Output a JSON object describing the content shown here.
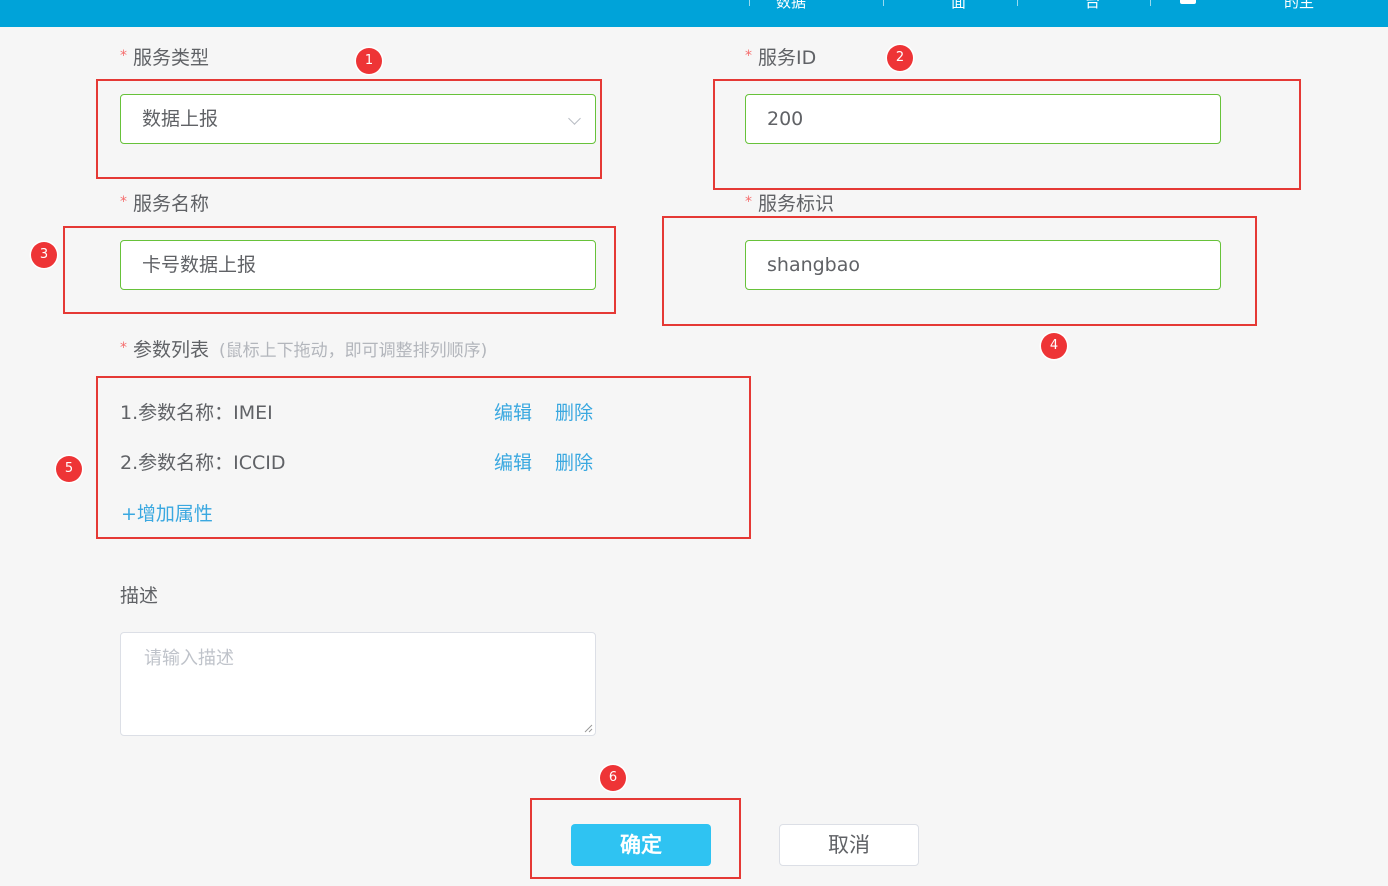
{
  "header": {
    "nav_fragments": [
      "数据",
      "面",
      "台",
      "的主"
    ],
    "background": "#00a3d9"
  },
  "form": {
    "service_type": {
      "label": "服务类型",
      "value": "数据上报"
    },
    "service_id": {
      "label": "服务ID",
      "value": "200"
    },
    "service_name": {
      "label": "服务名称",
      "value": "卡号数据上报"
    },
    "service_key": {
      "label": "服务标识",
      "value": "shangbao"
    },
    "params": {
      "label": "参数列表",
      "hint": "(鼠标上下拖动，即可调整排列顺序)",
      "items": [
        {
          "text": "1.参数名称：IMEI",
          "edit": "编辑",
          "delete": "删除"
        },
        {
          "text": "2.参数名称：ICCID",
          "edit": "编辑",
          "delete": "删除"
        }
      ],
      "add_label": "+增加属性"
    },
    "description": {
      "label": "描述",
      "placeholder": "请输入描述"
    },
    "required_mark": "*"
  },
  "actions": {
    "confirm": "确定",
    "cancel": "取消"
  },
  "markers": [
    "1",
    "2",
    "3",
    "4",
    "5",
    "6"
  ],
  "colors": {
    "accent": "#2fc3f2",
    "link": "#3aa8e0",
    "valid_border": "#67c23a",
    "highlight": "#e53935",
    "required": "#f56c6c"
  }
}
